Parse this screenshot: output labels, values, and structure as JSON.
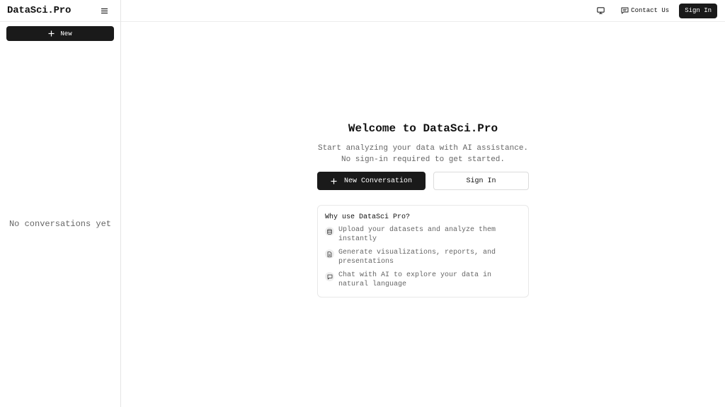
{
  "sidebar": {
    "brand": "DataSci.Pro",
    "menu_icon": "hamburger-menu-icon",
    "new_button": {
      "label": "New",
      "icon": "plus-icon"
    },
    "empty_text": "No conversations yet"
  },
  "topbar": {
    "monitor_icon": "monitor-icon",
    "contact": {
      "label": "Contact Us",
      "icon": "message-icon"
    },
    "signin_label": "Sign In"
  },
  "welcome": {
    "title": "Welcome to DataSci.Pro",
    "subtitle_line1": "Start analyzing your data with AI assistance.",
    "subtitle_line2": "No sign-in required to get started.",
    "primary_button": {
      "label": "New Conversation",
      "icon": "plus-icon"
    },
    "secondary_button": {
      "label": "Sign In"
    }
  },
  "why": {
    "title": "Why use DataSci Pro?",
    "features": [
      {
        "icon": "database-icon",
        "text": "Upload your datasets and analyze them instantly"
      },
      {
        "icon": "document-icon",
        "text": "Generate visualizations, reports, and presentations"
      },
      {
        "icon": "chat-icon",
        "text": "Chat with AI to explore your data in natural language"
      }
    ]
  },
  "colors": {
    "primary": "#1a1a1a",
    "muted_text": "#666666",
    "border": "#e5e5e5",
    "background": "#ffffff"
  }
}
